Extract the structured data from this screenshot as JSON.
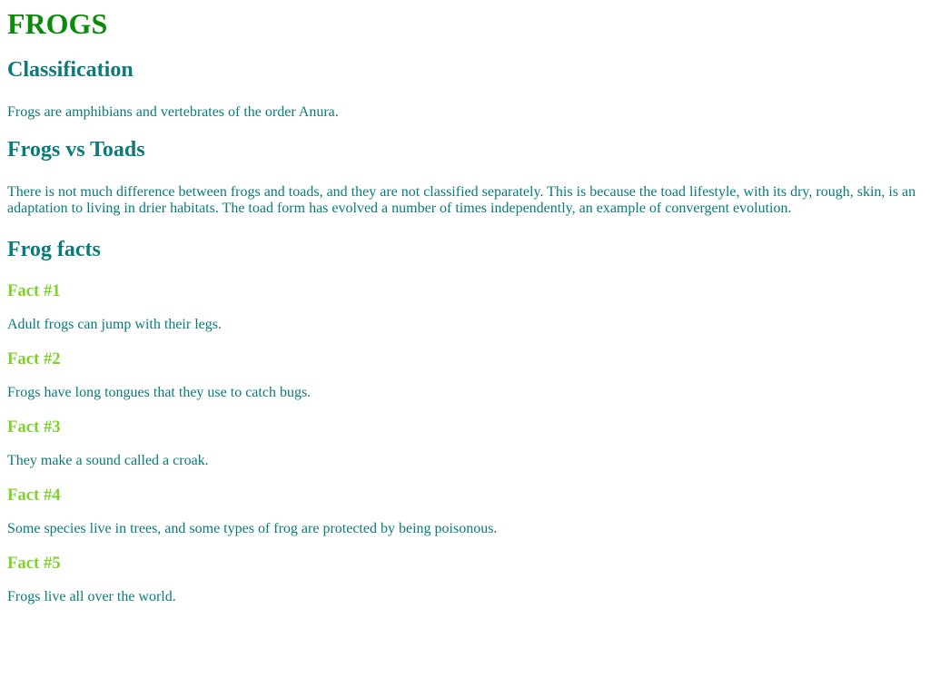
{
  "title": "FROGS",
  "classification": {
    "heading": "Classification",
    "text": "Frogs are amphibians and vertebrates of the order Anura."
  },
  "frogs_vs_toads": {
    "heading": "Frogs vs Toads",
    "text": "There is not much difference between frogs and toads, and they are not classified separately. This is because the toad lifestyle, with its dry, rough, skin, is an adaptation to living in drier habitats. The toad form has evolved a number of times independently, an example of convergent evolution."
  },
  "frog_facts": {
    "heading": "Frog facts",
    "facts": [
      {
        "title": "Fact #1",
        "text": "Adult frogs can jump with their legs."
      },
      {
        "title": "Fact #2",
        "text": "Frogs have long tongues that they use to catch bugs."
      },
      {
        "title": "Fact #3",
        "text": "They make a sound called a croak."
      },
      {
        "title": "Fact #4",
        "text": "Some species live in trees, and some types of frog are protected by being poisonous."
      },
      {
        "title": "Fact #5",
        "text": "Frogs live all over the world."
      }
    ]
  },
  "colors": {
    "title": "#0b8a0b",
    "section_heading": "#0b7a7a",
    "fact_heading": "#7fd22c",
    "body_text": "#0b7a7a"
  }
}
